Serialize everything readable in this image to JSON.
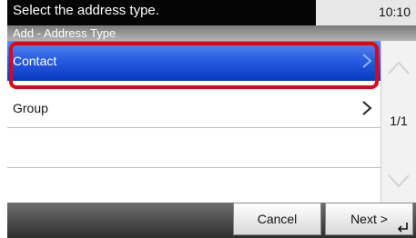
{
  "status": {
    "message": "Select the address type.",
    "time": "10:10"
  },
  "title": "Add - Address Type",
  "list": {
    "items": [
      {
        "label": "Contact",
        "selected": true
      },
      {
        "label": "Group",
        "selected": false
      },
      {
        "label": "",
        "selected": false
      },
      {
        "label": "",
        "selected": false
      }
    ]
  },
  "pager": {
    "current": "1/1"
  },
  "buttons": {
    "cancel": "Cancel",
    "next": "Next >"
  },
  "icons": {
    "row_arrow": "chevron-right-icon",
    "scroll_up": "scroll-up-arrow-icon",
    "scroll_down": "scroll-down-arrow-icon",
    "enter": "enter-return-icon"
  },
  "colors": {
    "selection_highlight": "#e00515",
    "selected_row": "#2a5fe2"
  }
}
